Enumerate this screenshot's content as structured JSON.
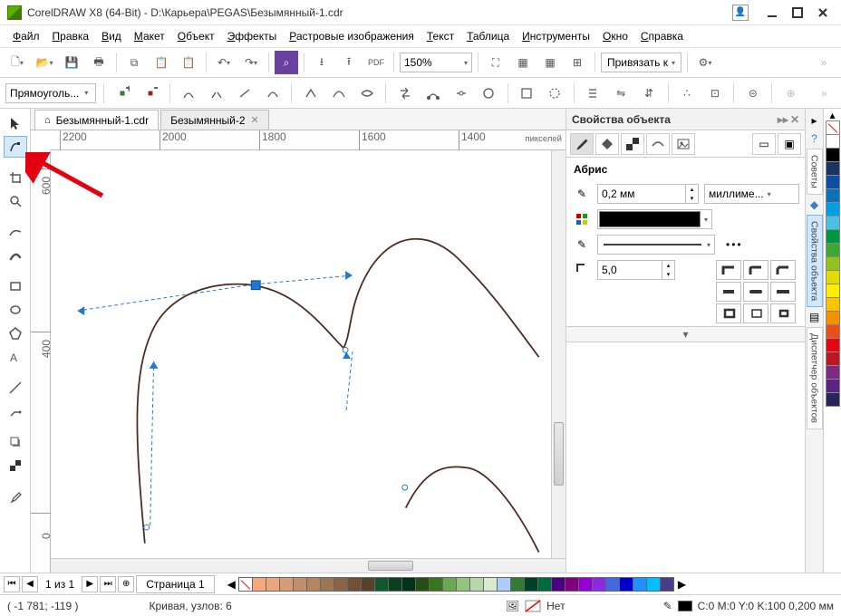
{
  "title": "CorelDRAW X8 (64-Bit) - D:\\Карьера\\PEGAS\\Безымянный-1.cdr",
  "menu": [
    "Файл",
    "Правка",
    "Вид",
    "Макет",
    "Объект",
    "Эффекты",
    "Растровые изображения",
    "Текст",
    "Таблица",
    "Инструменты",
    "Окно",
    "Справка"
  ],
  "zoom": "150%",
  "snap_to": "Привязать к",
  "propbar_shape": "Прямоуголь...",
  "doc_tabs": {
    "active": "Безымянный-1.cdr",
    "other": "Безымянный-2"
  },
  "ruler_units": "пикселей",
  "ruler_ticks_h": [
    "2200",
    "2000",
    "1800",
    "1600",
    "1400"
  ],
  "ruler_ticks_v": [
    "600",
    "400",
    "0"
  ],
  "props_panel": {
    "title": "Свойства объекта",
    "section": "Абрис",
    "width_value": "0,2 мм",
    "units": "миллиме...",
    "mitre": "5,0"
  },
  "side_tabs": [
    "Советы",
    "Свойства объекта",
    "Диспетчер объектов"
  ],
  "page_nav": {
    "label": "1  из  1",
    "page_tab": "Страница 1"
  },
  "status": {
    "coords": "( -1 781; -119  )",
    "curve": "Кривая, узлов: 6",
    "fill": "Нет",
    "outline": "C:0 M:0 Y:0 K:100  0,200 мм"
  },
  "palette_right": [
    "#ffffff",
    "#000000",
    "#1a355f",
    "#0b4f9e",
    "#0d72ba",
    "#009fe3",
    "#49c0e6",
    "#009640",
    "#3aaa35",
    "#95c11f",
    "#dedc00",
    "#ffed00",
    "#fdc300",
    "#f39200",
    "#e94e1b",
    "#e30613",
    "#be1622",
    "#7b2b81",
    "#5c2483",
    "#29235c"
  ],
  "palette_bottom": [
    "#f7a77d",
    "#eaa77d",
    "#d79b75",
    "#c28d6c",
    "#b38563",
    "#9b7654",
    "#876546",
    "#6e5136",
    "#55422a",
    "#115731",
    "#0a4020",
    "#003319",
    "#274e13",
    "#38761d",
    "#6aa84f",
    "#93c47d",
    "#b6d7a8",
    "#d9ead3",
    "#aecbfa",
    "#2e7d32",
    "#004225",
    "#00693e",
    "#4b0082",
    "#800080",
    "#9400d3",
    "#8a2be2",
    "#4169e1",
    "#0000cd",
    "#1e90ff",
    "#00bfff",
    "#483d8b"
  ]
}
